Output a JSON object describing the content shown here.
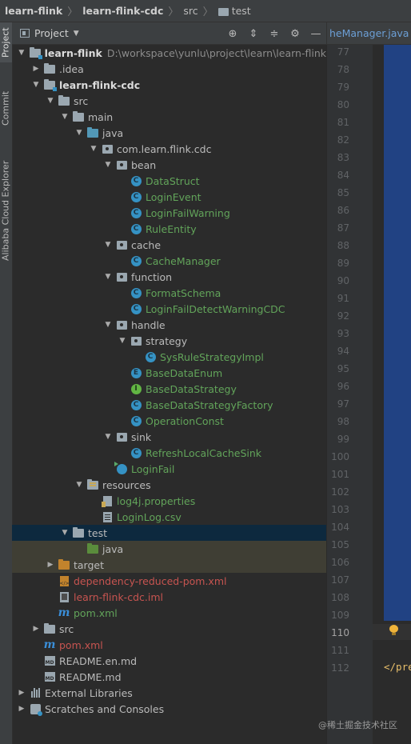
{
  "breadcrumb": [
    "learn-flink",
    "learn-flink-cdc",
    "src",
    "test"
  ],
  "tool_stripe": [
    "Project",
    "Commit",
    "Alibaba Cloud Explorer"
  ],
  "project_panel": {
    "title": "Project"
  },
  "editor": {
    "tab_label": "heManager.java",
    "line_numbers": [
      "77",
      "78",
      "79",
      "80",
      "81",
      "82",
      "83",
      "84",
      "85",
      "86",
      "87",
      "88",
      "89",
      "90",
      "91",
      "92",
      "93",
      "94",
      "95",
      "96",
      "97",
      "98",
      "99",
      "100",
      "101",
      "102",
      "103",
      "104",
      "105",
      "106",
      "107",
      "108",
      "109",
      "110",
      "111",
      "112"
    ],
    "current_line": "110",
    "code_line_112": "</pre"
  },
  "tree": [
    {
      "label": "learn-flink",
      "path": "D:\\workspace\\yunlu\\project\\learn\\learn-flink",
      "style": "bold",
      "icon": "folder-module",
      "arrow": "open",
      "indent": 0
    },
    {
      "label": ".idea",
      "style": "plain",
      "icon": "folder",
      "arrow": "closed",
      "indent": 1
    },
    {
      "label": "learn-flink-cdc",
      "style": "bold",
      "icon": "folder-module",
      "arrow": "open",
      "indent": 1
    },
    {
      "label": "src",
      "style": "plain",
      "icon": "folder",
      "arrow": "open",
      "indent": 2
    },
    {
      "label": "main",
      "style": "plain",
      "icon": "folder",
      "arrow": "open",
      "indent": 3
    },
    {
      "label": "java",
      "style": "plain",
      "icon": "folder-src",
      "arrow": "open",
      "indent": 4
    },
    {
      "label": "com.learn.flink.cdc",
      "style": "plain",
      "icon": "package",
      "arrow": "open",
      "indent": 5
    },
    {
      "label": "bean",
      "style": "plain",
      "icon": "package",
      "arrow": "open",
      "indent": 6
    },
    {
      "label": "DataStruct",
      "style": "green",
      "icon": "class",
      "arrow": "none",
      "indent": 7
    },
    {
      "label": "LoginEvent",
      "style": "green",
      "icon": "class",
      "arrow": "none",
      "indent": 7
    },
    {
      "label": "LoginFailWarning",
      "style": "green",
      "icon": "class",
      "arrow": "none",
      "indent": 7
    },
    {
      "label": "RuleEntity",
      "style": "green",
      "icon": "class",
      "arrow": "none",
      "indent": 7
    },
    {
      "label": "cache",
      "style": "plain",
      "icon": "package",
      "arrow": "open",
      "indent": 6
    },
    {
      "label": "CacheManager",
      "style": "green",
      "icon": "class",
      "arrow": "none",
      "indent": 7
    },
    {
      "label": "function",
      "style": "plain",
      "icon": "package",
      "arrow": "open",
      "indent": 6
    },
    {
      "label": "FormatSchema",
      "style": "green",
      "icon": "class",
      "arrow": "none",
      "indent": 7
    },
    {
      "label": "LoginFailDetectWarningCDC",
      "style": "green",
      "icon": "class",
      "arrow": "none",
      "indent": 7
    },
    {
      "label": "handle",
      "style": "plain",
      "icon": "package",
      "arrow": "open",
      "indent": 6
    },
    {
      "label": "strategy",
      "style": "plain",
      "icon": "package",
      "arrow": "open",
      "indent": 7
    },
    {
      "label": "SysRuleStrategyImpl",
      "style": "green",
      "icon": "class",
      "arrow": "none",
      "indent": 8
    },
    {
      "label": "BaseDataEnum",
      "style": "green",
      "icon": "enum",
      "arrow": "none",
      "indent": 7
    },
    {
      "label": "BaseDataStrategy",
      "style": "green",
      "icon": "interface",
      "arrow": "none",
      "indent": 7
    },
    {
      "label": "BaseDataStrategyFactory",
      "style": "green",
      "icon": "class",
      "arrow": "none",
      "indent": 7
    },
    {
      "label": "OperationConst",
      "style": "green",
      "icon": "class",
      "arrow": "none",
      "indent": 7
    },
    {
      "label": "sink",
      "style": "plain",
      "icon": "package",
      "arrow": "open",
      "indent": 6
    },
    {
      "label": "RefreshLocalCacheSink",
      "style": "green",
      "icon": "class",
      "arrow": "none",
      "indent": 7
    },
    {
      "label": "LoginFail",
      "style": "green",
      "icon": "runnable-class",
      "arrow": "none",
      "indent": 6
    },
    {
      "label": "resources",
      "style": "plain",
      "icon": "folder-res",
      "arrow": "open",
      "indent": 4
    },
    {
      "label": "log4j.properties",
      "style": "green",
      "icon": "properties",
      "arrow": "none",
      "indent": 5
    },
    {
      "label": "LoginLog.csv",
      "style": "green",
      "icon": "csv",
      "arrow": "none",
      "indent": 5
    },
    {
      "label": "test",
      "style": "plain",
      "icon": "folder",
      "arrow": "open",
      "indent": 3,
      "state": "selected"
    },
    {
      "label": "java",
      "style": "plain",
      "icon": "folder-test",
      "arrow": "none",
      "indent": 4,
      "state": "highlight"
    },
    {
      "label": "target",
      "style": "plain",
      "icon": "folder-target",
      "arrow": "closed",
      "indent": 2,
      "state": "highlight"
    },
    {
      "label": "dependency-reduced-pom.xml",
      "style": "red",
      "icon": "xml",
      "arrow": "none",
      "indent": 2
    },
    {
      "label": "learn-flink-cdc.iml",
      "style": "red",
      "icon": "iml",
      "arrow": "none",
      "indent": 2
    },
    {
      "label": "pom.xml",
      "style": "green",
      "icon": "maven",
      "arrow": "none",
      "indent": 2
    },
    {
      "label": "src",
      "style": "plain",
      "icon": "folder",
      "arrow": "closed",
      "indent": 1
    },
    {
      "label": "pom.xml",
      "style": "red",
      "icon": "maven",
      "arrow": "none",
      "indent": 1
    },
    {
      "label": "README.en.md",
      "style": "plain",
      "icon": "md",
      "arrow": "none",
      "indent": 1
    },
    {
      "label": "README.md",
      "style": "plain",
      "icon": "md",
      "arrow": "none",
      "indent": 1
    },
    {
      "label": "External Libraries",
      "style": "plain",
      "icon": "libraries",
      "arrow": "closed",
      "indent": 0
    },
    {
      "label": "Scratches and Consoles",
      "style": "plain",
      "icon": "scratches",
      "arrow": "closed",
      "indent": 0
    }
  ],
  "watermark": "@稀土掘金技术社区"
}
